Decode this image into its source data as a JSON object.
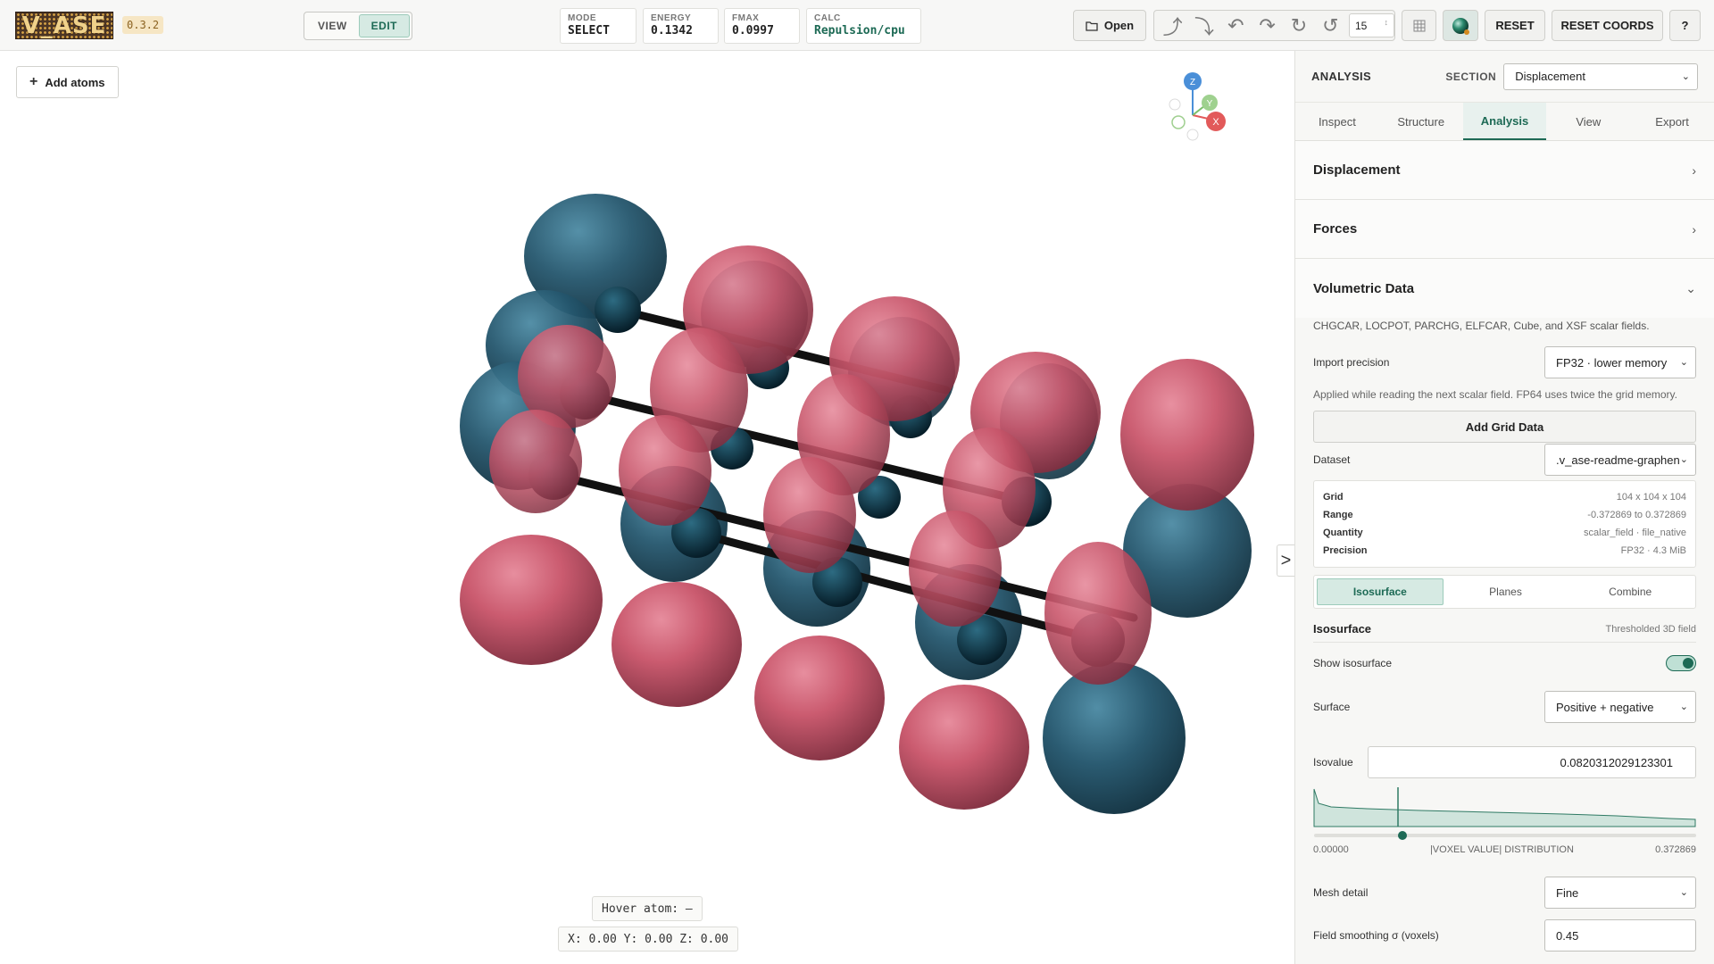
{
  "app": {
    "logo_text": "V_ASE",
    "version": "0.3.2"
  },
  "toolbar": {
    "mode_toggle": {
      "view_label": "VIEW",
      "edit_label": "EDIT",
      "active": "EDIT"
    },
    "stats": [
      {
        "label": "MODE",
        "value": "SELECT"
      },
      {
        "label": "ENERGY",
        "value": "0.1342"
      },
      {
        "label": "FMAX",
        "value": "0.0997"
      },
      {
        "label": "CALC",
        "value": "Repulsion/cpu"
      }
    ],
    "open_label": "Open",
    "open_icon": "folder-icon",
    "tool_icons": [
      "rotate-up-icon",
      "rotate-down-icon",
      "rotate-left-icon",
      "rotate-right-icon",
      "rotate-ccw-icon",
      "rotate-cw-icon"
    ],
    "rotation_step": "15",
    "reset_label": "RESET",
    "reset_coords_label": "RESET COORDS",
    "help_label": "?"
  },
  "viewport": {
    "add_atoms_label": "Add atoms",
    "axes": {
      "z": "Z",
      "y": "Y",
      "x": "X"
    },
    "hover_text": "Hover atom: –",
    "coords_text": "X: 0.00 Y: 0.00 Z: 0.00",
    "collapse_glyph": ">",
    "colors": {
      "positive_lobe": "#c9566b",
      "negative_lobe": "#24566d",
      "atom": "#0d3a4c"
    }
  },
  "panel": {
    "title": "ANALYSIS",
    "section_label": "SECTION",
    "section_value": "Displacement",
    "tabs": [
      "Inspect",
      "Structure",
      "Analysis",
      "View",
      "Export"
    ],
    "active_tab": "Analysis",
    "sections": [
      {
        "name": "Displacement",
        "expanded": false
      },
      {
        "name": "Forces",
        "expanded": false
      },
      {
        "name": "Volumetric Data",
        "expanded": true
      }
    ],
    "volumetric": {
      "description": "CHGCAR, LOCPOT, PARCHG, ELFCAR, Cube, and XSF scalar fields.",
      "import_precision_label": "Import precision",
      "import_precision_value": "FP32 · lower memory",
      "precision_hint": "Applied while reading the next scalar field. FP64 uses twice the grid memory.",
      "add_grid_label": "Add Grid Data",
      "dataset_label": "Dataset",
      "dataset_value": ".v_ase-readme-graphen",
      "info": [
        {
          "key": "Grid",
          "value": "104 x 104 x 104"
        },
        {
          "key": "Range",
          "value": "-0.372869 to 0.372869"
        },
        {
          "key": "Quantity",
          "value": "scalar_field · file_native"
        },
        {
          "key": "Precision",
          "value": "FP32 · 4.3 MiB"
        }
      ],
      "subtabs": [
        "Isosurface",
        "Planes",
        "Combine"
      ],
      "active_subtab": "Isosurface",
      "iso_title": "Isosurface",
      "iso_subtitle": "Thresholded 3D field",
      "show_iso_label": "Show isosurface",
      "show_iso": true,
      "surface_label": "Surface",
      "surface_value": "Positive + negative",
      "isovalue_label": "Isovalue",
      "isovalue": "0.0820312029123301",
      "hist_min": "0.00000",
      "hist_caption": "|VOXEL VALUE| DISTRIBUTION",
      "hist_max": "0.372869",
      "mesh_label": "Mesh detail",
      "mesh_value": "Fine",
      "smoothing_label": "Field smoothing σ (voxels)",
      "smoothing_value": "0.45"
    }
  }
}
